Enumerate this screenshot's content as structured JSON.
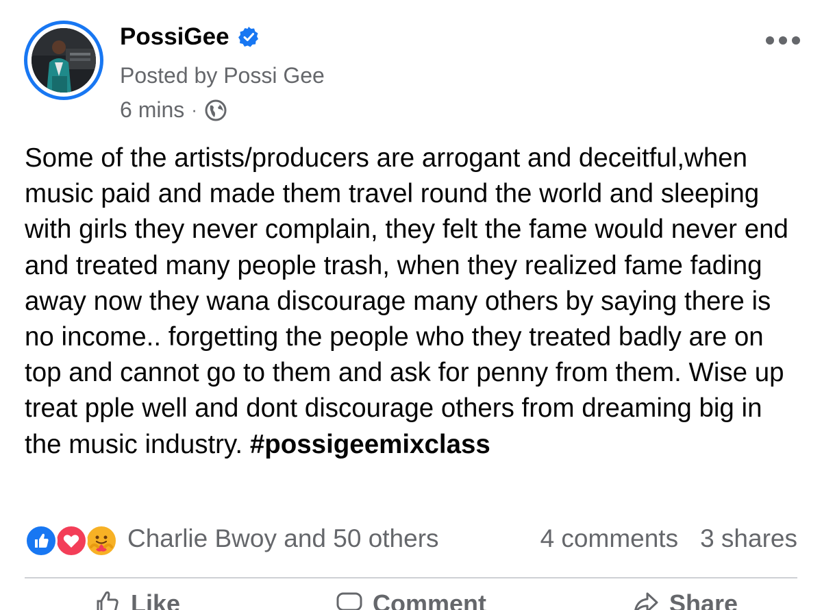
{
  "post": {
    "page_name": "PossiGee",
    "posted_by": "Posted by Possi Gee",
    "time": "6 mins",
    "separator": "·",
    "text": "Some of the artists/producers are arrogant and deceitful,when music paid and made them travel round the world and sleeping with girls they never complain, they felt the fame would never end and treated many people trash, when they realized fame fading away now they wana discourage many others by saying there is no income.. forgetting the people who they treated badly are on top and cannot go to them and ask for penny from them. Wise up treat pple well and dont discourage others from dreaming big in the music industry.",
    "hashtag": "#possigeemixclass"
  },
  "reactions": {
    "icons": [
      "like-icon",
      "love-icon",
      "care-icon"
    ],
    "reactors": "Charlie Bwoy and 50 others",
    "comments": "4 comments",
    "shares": "3 shares"
  },
  "actions": [
    {
      "label": "Like",
      "icon": "thumbs-up-icon"
    },
    {
      "label": "Comment",
      "icon": "comment-icon"
    },
    {
      "label": "Share",
      "icon": "share-icon"
    }
  ],
  "colors": {
    "brand_blue": "#1877f2",
    "secondary_text": "#65676b",
    "primary_text": "#050505",
    "love_red": "#f33e58",
    "care_yellow": "#f7b125"
  }
}
